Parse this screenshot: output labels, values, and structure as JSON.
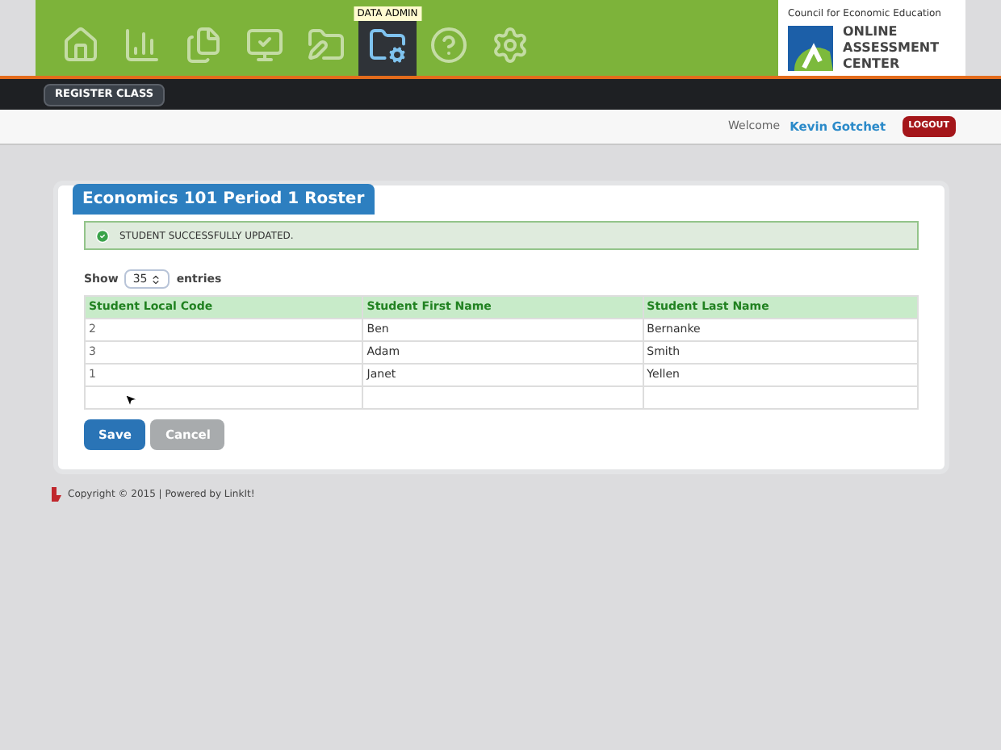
{
  "nav": {
    "items": [
      {
        "kind": "home",
        "selected": false
      },
      {
        "kind": "reports",
        "selected": false
      },
      {
        "kind": "documents",
        "selected": false
      },
      {
        "kind": "monitor",
        "selected": false
      },
      {
        "kind": "editor",
        "selected": false
      },
      {
        "kind": "admin",
        "selected": true,
        "tooltip": "DATA ADMIN"
      },
      {
        "kind": "help",
        "selected": false
      },
      {
        "kind": "settings",
        "selected": false
      }
    ]
  },
  "logo": {
    "organization": "Council for Economic Education",
    "lines": [
      "ONLINE",
      "ASSESSMENT",
      "CENTER"
    ]
  },
  "toolbar": {
    "button": "REGISTER CLASS"
  },
  "user_bar": {
    "welcome": "Welcome",
    "user": "Kevin Gotchet",
    "logout": "LOGOUT"
  },
  "panel": {
    "title": "Economics 101 Period 1 Roster",
    "alert": "STUDENT SUCCESSFULLY UPDATED.",
    "show_label": "Show",
    "entries_value": "35",
    "entries_label": "entries",
    "table": {
      "columns": [
        "Student Local Code",
        "Student First Name",
        "Student Last Name"
      ],
      "rows": [
        [
          "2",
          "Ben",
          "Bernanke"
        ],
        [
          "3",
          "Adam",
          "Smith"
        ],
        [
          "1",
          "Janet",
          "Yellen"
        ]
      ]
    },
    "buttons": [
      {
        "label": "Save",
        "kind": "primary"
      },
      {
        "label": "Cancel",
        "kind": "secondary"
      }
    ]
  },
  "footer": {
    "text": "Copyright © 2015 | Powered by LinkIt!"
  }
}
